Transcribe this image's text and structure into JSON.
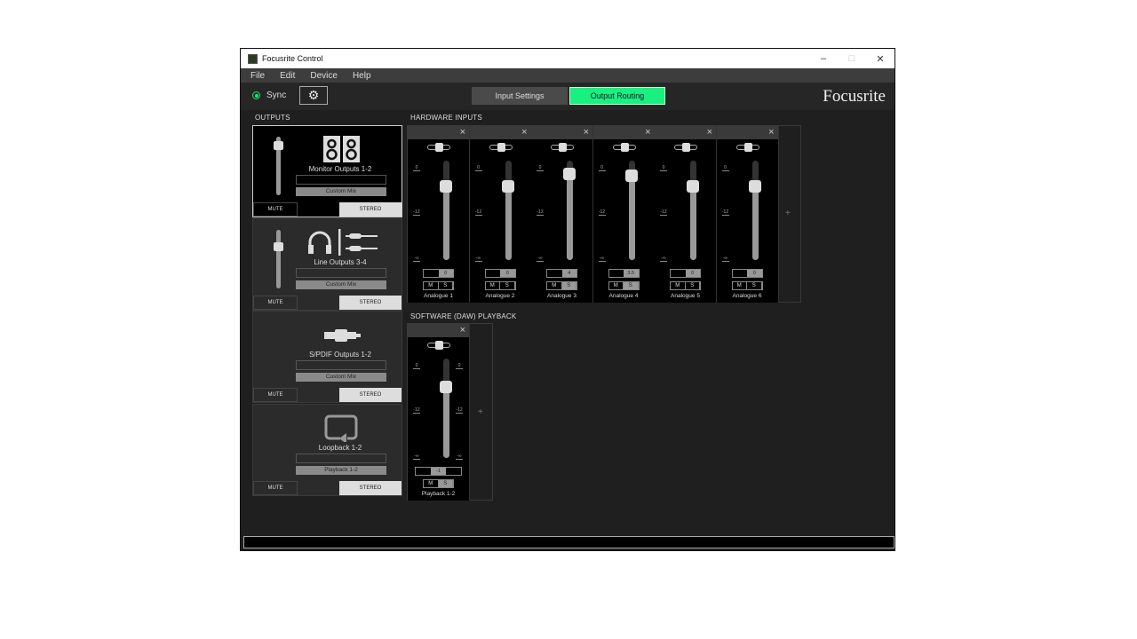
{
  "window": {
    "title": "Focusrite Control",
    "minimize": "–",
    "maximize": "□",
    "close": "✕"
  },
  "menu": [
    "File",
    "Edit",
    "Device",
    "Help"
  ],
  "toolbar": {
    "sync_label": "Sync",
    "settings_icon": "gear-icon",
    "tabs": [
      "Input Settings",
      "Output Routing"
    ],
    "active_tab": "Output Routing",
    "brand": "Focusrite"
  },
  "colors": {
    "accent": "#19f07f"
  },
  "outputs": {
    "title": "OUTPUTS",
    "cards": [
      {
        "name": "Monitor Outputs 1-2",
        "icon": "speakers-icon",
        "source": "Custom Mix",
        "mute": "MUTE",
        "mode": "STEREO",
        "fader_level": 0.9,
        "selected": true,
        "has_fader": true
      },
      {
        "name": "Line Outputs 3-4",
        "icon": "headphones-jack-icon",
        "source": "Custom Mix",
        "mute": "MUTE",
        "mode": "STEREO",
        "fader_level": 0.75,
        "selected": false,
        "has_fader": true
      },
      {
        "name": "S/PDIF Outputs 1-2",
        "icon": "spdif-cable-icon",
        "source": "Custom Mix",
        "mute": "MUTE",
        "mode": "STEREO",
        "selected": false,
        "has_fader": false
      },
      {
        "name": "Loopback 1-2",
        "icon": "loopback-icon",
        "source": "Playback 1-2",
        "mute": "MUTE",
        "mode": "STEREO",
        "selected": false,
        "has_fader": false
      }
    ]
  },
  "hardware_inputs": {
    "title": "HARDWARE INPUTS",
    "scale": [
      "0",
      "-12",
      "-∞"
    ],
    "add": "+",
    "channels": [
      {
        "name": "Analogue 1",
        "gain": "0",
        "gain_db": 0,
        "m": "M",
        "s": "S",
        "solo": false
      },
      {
        "name": "Analogue 2",
        "gain": "0",
        "gain_db": 0,
        "m": "M",
        "s": "S",
        "solo": false
      },
      {
        "name": "Analogue 3",
        "gain": "4",
        "gain_db": 4,
        "m": "M",
        "s": "S",
        "solo": true
      },
      {
        "name": "Analogue 4",
        "gain": "3.5",
        "gain_db": 3.5,
        "m": "M",
        "s": "S",
        "solo": true
      },
      {
        "name": "Analogue 5",
        "gain": "0",
        "gain_db": 0,
        "m": "M",
        "s": "S",
        "solo": false
      },
      {
        "name": "Analogue 6",
        "gain": "0",
        "gain_db": 0,
        "m": "M",
        "s": "S",
        "solo": false
      }
    ]
  },
  "playback": {
    "title": "SOFTWARE (DAW) PLAYBACK",
    "scale": [
      "0",
      "-12",
      "-∞"
    ],
    "add": "+",
    "channels": [
      {
        "name": "Playback 1-2",
        "gain": "-1",
        "gain_db": -1,
        "m": "M",
        "s": "S",
        "solo": true
      }
    ]
  }
}
